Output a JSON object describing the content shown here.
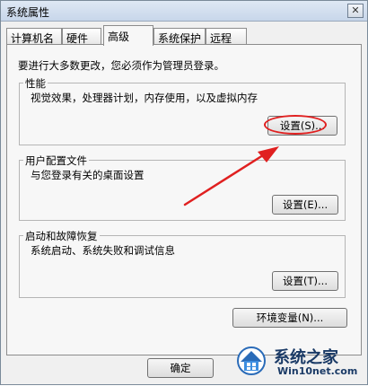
{
  "window": {
    "title": "系统属性",
    "close_label": "✕"
  },
  "tabs": [
    {
      "label": "计算机名"
    },
    {
      "label": "硬件"
    },
    {
      "label": "高级"
    },
    {
      "label": "系统保护"
    },
    {
      "label": "远程"
    }
  ],
  "note": "要进行大多数更改，您必须作为管理员登录。",
  "groups": {
    "performance": {
      "title": "性能",
      "desc": "视觉效果，处理器计划，内存使用，以及虚拟内存",
      "button": "设置(S)..."
    },
    "profile": {
      "title": "用户配置文件",
      "desc": "与您登录有关的桌面设置",
      "button": "设置(E)..."
    },
    "startup": {
      "title": "启动和故障恢复",
      "desc": "系统启动、系统失败和调试信息",
      "button": "设置(T)..."
    }
  },
  "env_button": "环境变量(N)...",
  "footer": {
    "ok": "确定"
  },
  "watermark": {
    "name": "系统之家",
    "url": "Win10net.com"
  },
  "colors": {
    "annotation": "#e02020",
    "watermark": "#1a3a66"
  }
}
